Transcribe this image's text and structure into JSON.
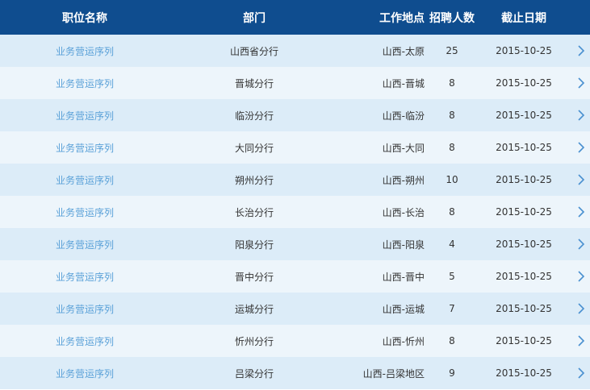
{
  "columns": [
    "职位名称",
    "部门",
    "工作地点",
    "招聘人数",
    "截止日期"
  ],
  "rows": [
    {
      "position": "业务营运序列",
      "dept": "山西省分行",
      "location": "山西-太原",
      "count": "25",
      "deadline": "2015-10-25"
    },
    {
      "position": "业务营运序列",
      "dept": "晋城分行",
      "location": "山西-晋城",
      "count": "8",
      "deadline": "2015-10-25"
    },
    {
      "position": "业务营运序列",
      "dept": "临汾分行",
      "location": "山西-临汾",
      "count": "8",
      "deadline": "2015-10-25"
    },
    {
      "position": "业务营运序列",
      "dept": "大同分行",
      "location": "山西-大同",
      "count": "8",
      "deadline": "2015-10-25"
    },
    {
      "position": "业务营运序列",
      "dept": "朔州分行",
      "location": "山西-朔州",
      "count": "10",
      "deadline": "2015-10-25"
    },
    {
      "position": "业务营运序列",
      "dept": "长治分行",
      "location": "山西-长治",
      "count": "8",
      "deadline": "2015-10-25"
    },
    {
      "position": "业务营运序列",
      "dept": "阳泉分行",
      "location": "山西-阳泉",
      "count": "4",
      "deadline": "2015-10-25"
    },
    {
      "position": "业务营运序列",
      "dept": "晋中分行",
      "location": "山西-晋中",
      "count": "5",
      "deadline": "2015-10-25"
    },
    {
      "position": "业务营运序列",
      "dept": "运城分行",
      "location": "山西-运城",
      "count": "7",
      "deadline": "2015-10-25"
    },
    {
      "position": "业务营运序列",
      "dept": "忻州分行",
      "location": "山西-忻州",
      "count": "8",
      "deadline": "2015-10-25"
    },
    {
      "position": "业务营运序列",
      "dept": "吕梁分行",
      "location": "山西-吕梁地区",
      "count": "9",
      "deadline": "2015-10-25"
    }
  ],
  "icons": {
    "row_arrow": "chevron-right-icon"
  },
  "colors": {
    "header_bg": "#0f4d8f",
    "row_alt_a": "#dcecf8",
    "row_alt_b": "#edf5fb",
    "link": "#5aa1d8",
    "chevron": "#4a90d0"
  }
}
